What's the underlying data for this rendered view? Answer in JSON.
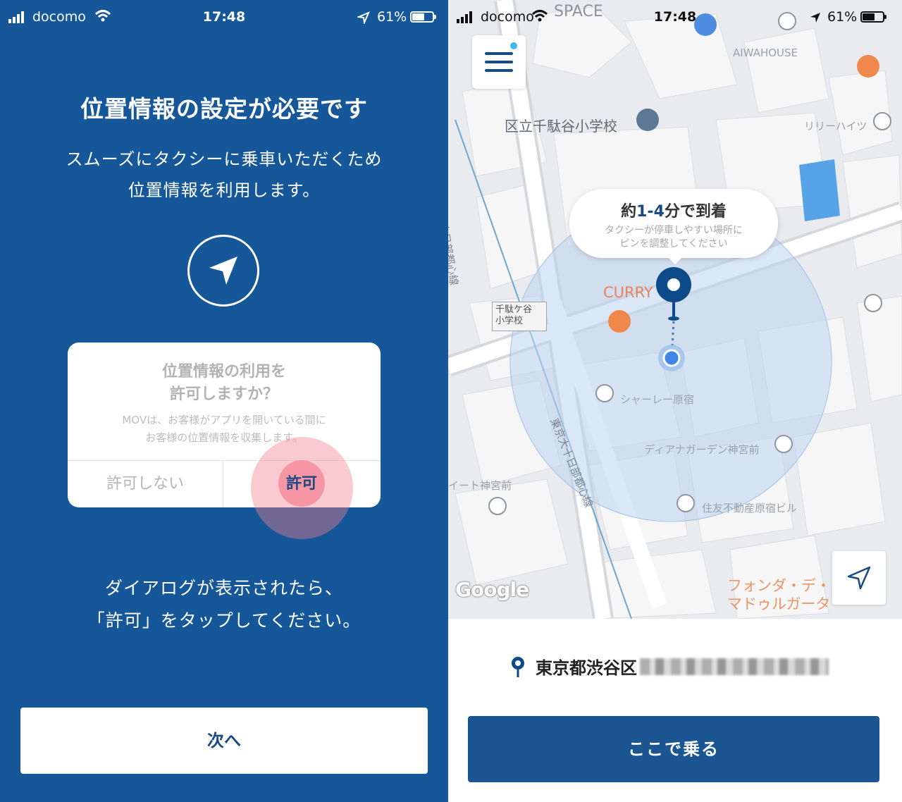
{
  "left": {
    "status": {
      "carrier": "docomo",
      "time": "17:48",
      "battery": "61%"
    },
    "title": "位置情報の設定が必要です",
    "description": [
      "スムーズにタクシーに乗車いただくため",
      "位置情報を利用します。"
    ],
    "dialog": {
      "title": "位置情報の利用を\n許可しますか？",
      "message": "MOVは、お客様がアプリを開いている間に\nお客様の位置情報を収集します。",
      "deny_label": "許可しない",
      "allow_label": "許可"
    },
    "instruction": [
      "ダイアログが表示されたら、",
      "「許可」をタップしてください。"
    ],
    "next_label": "次へ",
    "colors": {
      "background": "#16579a",
      "accent": "#1b4a82",
      "tap": "#f28092"
    }
  },
  "right": {
    "status": {
      "carrier": "docomo",
      "time": "17:48",
      "battery": "61%"
    },
    "map_labels": {
      "school": "区立千駄谷小学校",
      "curry": "CURRY",
      "aiwahouse": "AIWAHOUSE",
      "lily": "リリーハイツ",
      "chateau": "シャーレー原宿",
      "diana": "ディアナガーデン神宮前",
      "sumitomo": "住友不動産原宿ビル",
      "school_small": "千駄ケ谷\n小学校",
      "street1": "東京大十日部都心線",
      "street2": "東京大十日部都心線",
      "ito": "イート神宮前",
      "space": "SPACE",
      "fonda": "フォンダ・デ・\nマドゥルガータ",
      "google": "Google"
    },
    "eta": {
      "prefix": "約",
      "range": "1-4",
      "suffix": "分で到着",
      "hint": "タクシーが停車しやすい場所に\nピンを調整してください"
    },
    "address": "東京都渋谷区",
    "ride_label": "ここで乗る",
    "colors": {
      "button": "#1b5592",
      "pin": "#0d4a8a",
      "radius": "#bcd3ee"
    }
  }
}
